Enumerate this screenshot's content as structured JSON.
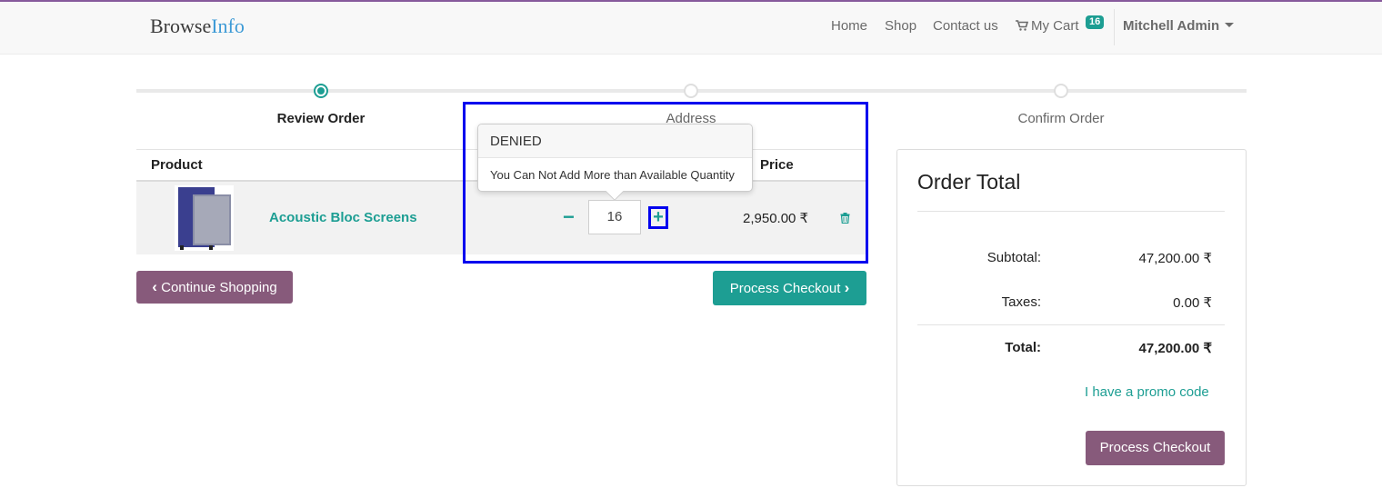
{
  "brand": {
    "part1": "Browse",
    "part2": "Info"
  },
  "nav": {
    "home": "Home",
    "shop": "Shop",
    "contact": "Contact us",
    "cart": "My Cart",
    "cart_count": "16",
    "user": "Mitchell Admin"
  },
  "steps": [
    {
      "label": "Review Order",
      "active": true
    },
    {
      "label": "Address",
      "active": false
    },
    {
      "label": "Confirm Order",
      "active": false
    }
  ],
  "table": {
    "headers": {
      "product": "Product",
      "price": "Price"
    },
    "row": {
      "name": "Acoustic Bloc Screens",
      "minus": "−",
      "quantity": "16",
      "plus": "+",
      "price": "2,950.00 ₹"
    }
  },
  "tooltip": {
    "title": "DENIED",
    "message": "You Can Not Add More than Available Quantity"
  },
  "buttons": {
    "continue": "Continue Shopping",
    "checkout": "Process Checkout"
  },
  "order_total": {
    "title": "Order Total",
    "subtotal_label": "Subtotal:",
    "subtotal_value": "47,200.00 ₹",
    "taxes_label": "Taxes:",
    "taxes_value": "0.00 ₹",
    "total_label": "Total:",
    "total_value": "47,200.00 ₹",
    "promo": "I have a promo code",
    "checkout": "Process Checkout"
  },
  "colors": {
    "accent": "#1d9e93",
    "brand_purple": "#875a7b",
    "highlight": "#0000ee"
  }
}
